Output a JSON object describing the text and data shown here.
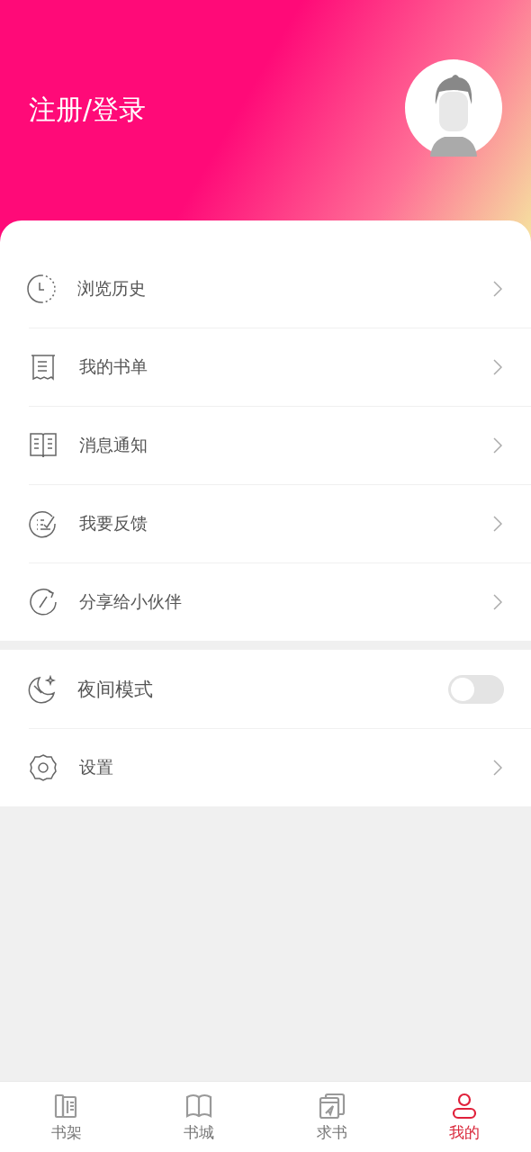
{
  "header": {
    "login_label": "注册/登录"
  },
  "menu_groups": [
    {
      "items": [
        {
          "kind": "link",
          "label": "浏览历史"
        },
        {
          "kind": "link",
          "label": "我的书单"
        },
        {
          "kind": "link",
          "label": "消息通知"
        },
        {
          "kind": "link",
          "label": "我要反馈"
        },
        {
          "kind": "link",
          "label": "分享给小伙伴"
        }
      ]
    },
    {
      "items": [
        {
          "kind": "toggle",
          "label": "夜间模式",
          "on": false
        },
        {
          "kind": "link",
          "label": "设置"
        }
      ]
    }
  ],
  "tab_bar": [
    {
      "label": "书架",
      "selected": false
    },
    {
      "label": "书城",
      "selected": false
    },
    {
      "label": "求书",
      "selected": false
    },
    {
      "label": "我的",
      "selected": true
    }
  ]
}
